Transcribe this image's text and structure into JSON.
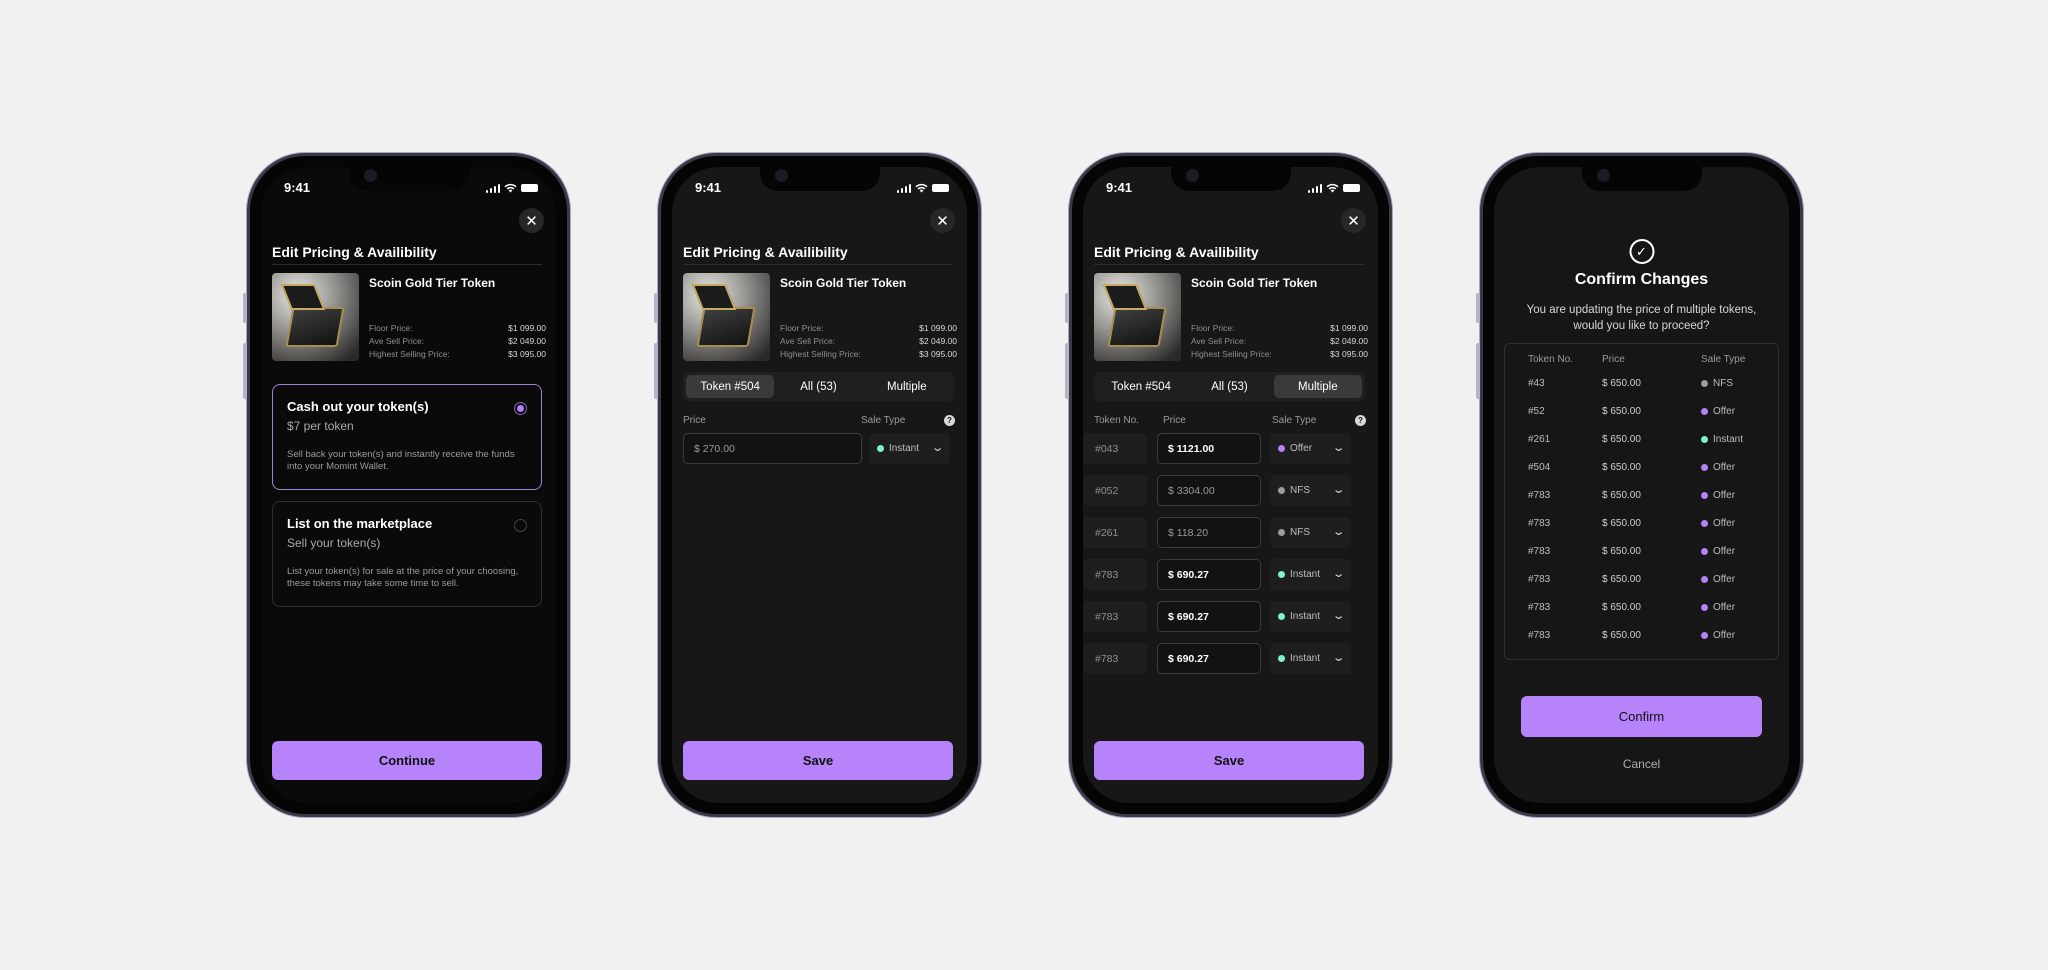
{
  "status_time": "9:41",
  "screen_title": "Edit Pricing & Availibility",
  "product": {
    "name": "Scoin Gold Tier Token",
    "stats": [
      {
        "label": "Floor Price:",
        "value": "$1 099.00"
      },
      {
        "label": "Ave Sell Price:",
        "value": "$2 049.00"
      },
      {
        "label": "Highest Selling Price:",
        "value": "$3 095.00"
      }
    ]
  },
  "screen1": {
    "options": [
      {
        "title": "Cash out your token(s)",
        "subtitle": "$7 per token",
        "desc": "Sell back your token(s) and instantly receive the funds into your Momint Wallet.",
        "selected": true
      },
      {
        "title": "List on the marketplace",
        "subtitle": "Sell your token(s)",
        "desc": "List your token(s) for sale at the price of your choosing, these tokens may take some time to sell.",
        "selected": false
      }
    ],
    "button": "Continue"
  },
  "tabs": [
    "Token #504",
    "All (53)",
    "Multiple"
  ],
  "screen2": {
    "price_label": "Price",
    "sale_type_label": "Sale Type",
    "help": "?",
    "price_placeholder": "$ 270.00",
    "sale_type": "Instant",
    "button": "Save"
  },
  "screen3": {
    "headers": [
      "Token No.",
      "Price",
      "Sale Type"
    ],
    "rows": [
      {
        "token": "#043",
        "price": "$ 1121.00",
        "bright": true,
        "type": "Offer",
        "color": "#b681f6"
      },
      {
        "token": "#052",
        "price": "$ 3304.00",
        "bright": false,
        "type": "NFS",
        "color": "#9d9d9d"
      },
      {
        "token": "#261",
        "price": "$ 118.20",
        "bright": false,
        "type": "NFS",
        "color": "#9d9d9d"
      },
      {
        "token": "#783",
        "price": "$ 690.27",
        "bright": true,
        "type": "Instant",
        "color": "#7ff2cd"
      },
      {
        "token": "#783",
        "price": "$ 690.27",
        "bright": true,
        "type": "Instant",
        "color": "#7ff2cd"
      },
      {
        "token": "#783",
        "price": "$ 690.27",
        "bright": true,
        "type": "Instant",
        "color": "#7ff2cd"
      }
    ],
    "button": "Save"
  },
  "screen4": {
    "title": "Confirm Changes",
    "desc": "You are updating the price of multiple tokens, would you like to proceed?",
    "headers": [
      "Token No.",
      "Price",
      "Sale Type"
    ],
    "rows": [
      {
        "token": "#43",
        "price": "$ 650.00",
        "type": "NFS",
        "color": "#9d9d9d"
      },
      {
        "token": "#52",
        "price": "$ 650.00",
        "type": "Offer",
        "color": "#b681f6"
      },
      {
        "token": "#261",
        "price": "$ 650.00",
        "type": "Instant",
        "color": "#7ff2cd"
      },
      {
        "token": "#504",
        "price": "$ 650.00",
        "type": "Offer",
        "color": "#b681f6"
      },
      {
        "token": "#783",
        "price": "$ 650.00",
        "type": "Offer",
        "color": "#b681f6"
      },
      {
        "token": "#783",
        "price": "$ 650.00",
        "type": "Offer",
        "color": "#b681f6"
      },
      {
        "token": "#783",
        "price": "$ 650.00",
        "type": "Offer",
        "color": "#b681f6"
      },
      {
        "token": "#783",
        "price": "$ 650.00",
        "type": "Offer",
        "color": "#b681f6"
      },
      {
        "token": "#783",
        "price": "$ 650.00",
        "type": "Offer",
        "color": "#b681f6"
      },
      {
        "token": "#783",
        "price": "$ 650.00",
        "type": "Offer",
        "color": "#b681f6"
      }
    ],
    "confirm": "Confirm",
    "cancel": "Cancel"
  }
}
